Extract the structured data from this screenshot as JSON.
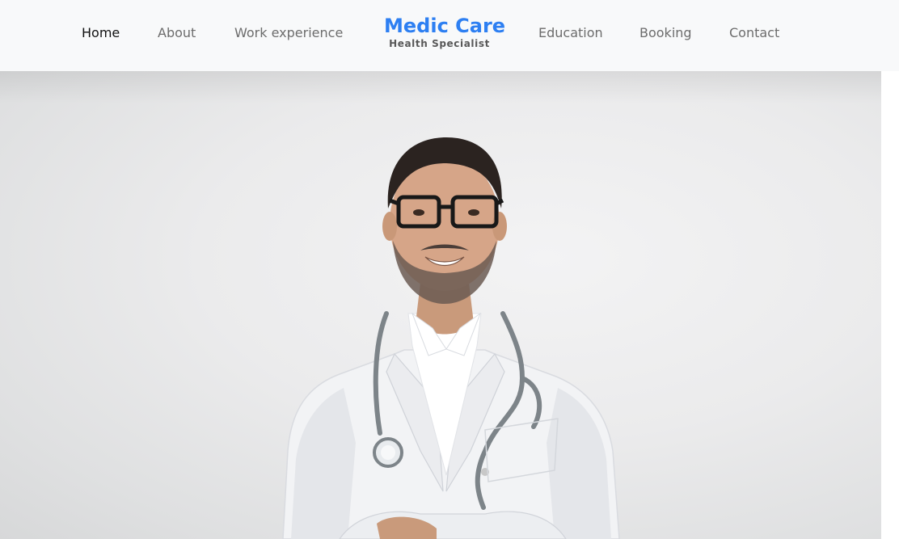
{
  "nav": {
    "left_links": [
      {
        "label": "Home",
        "active": true
      },
      {
        "label": "About",
        "active": false
      },
      {
        "label": "Work experience",
        "active": false
      }
    ],
    "brand": {
      "name": "Medic Care",
      "tagline": "Health Specialist"
    },
    "right_links": [
      {
        "label": "Education",
        "active": false
      },
      {
        "label": "Booking",
        "active": false
      },
      {
        "label": "Contact",
        "active": false
      }
    ]
  },
  "hero": {
    "image": "doctor-portrait"
  },
  "colors": {
    "brand": "#2d7ff2",
    "nav_text": "#6c6c6c",
    "nav_active": "#111111",
    "navbar_bg": "#f8f9fa"
  }
}
